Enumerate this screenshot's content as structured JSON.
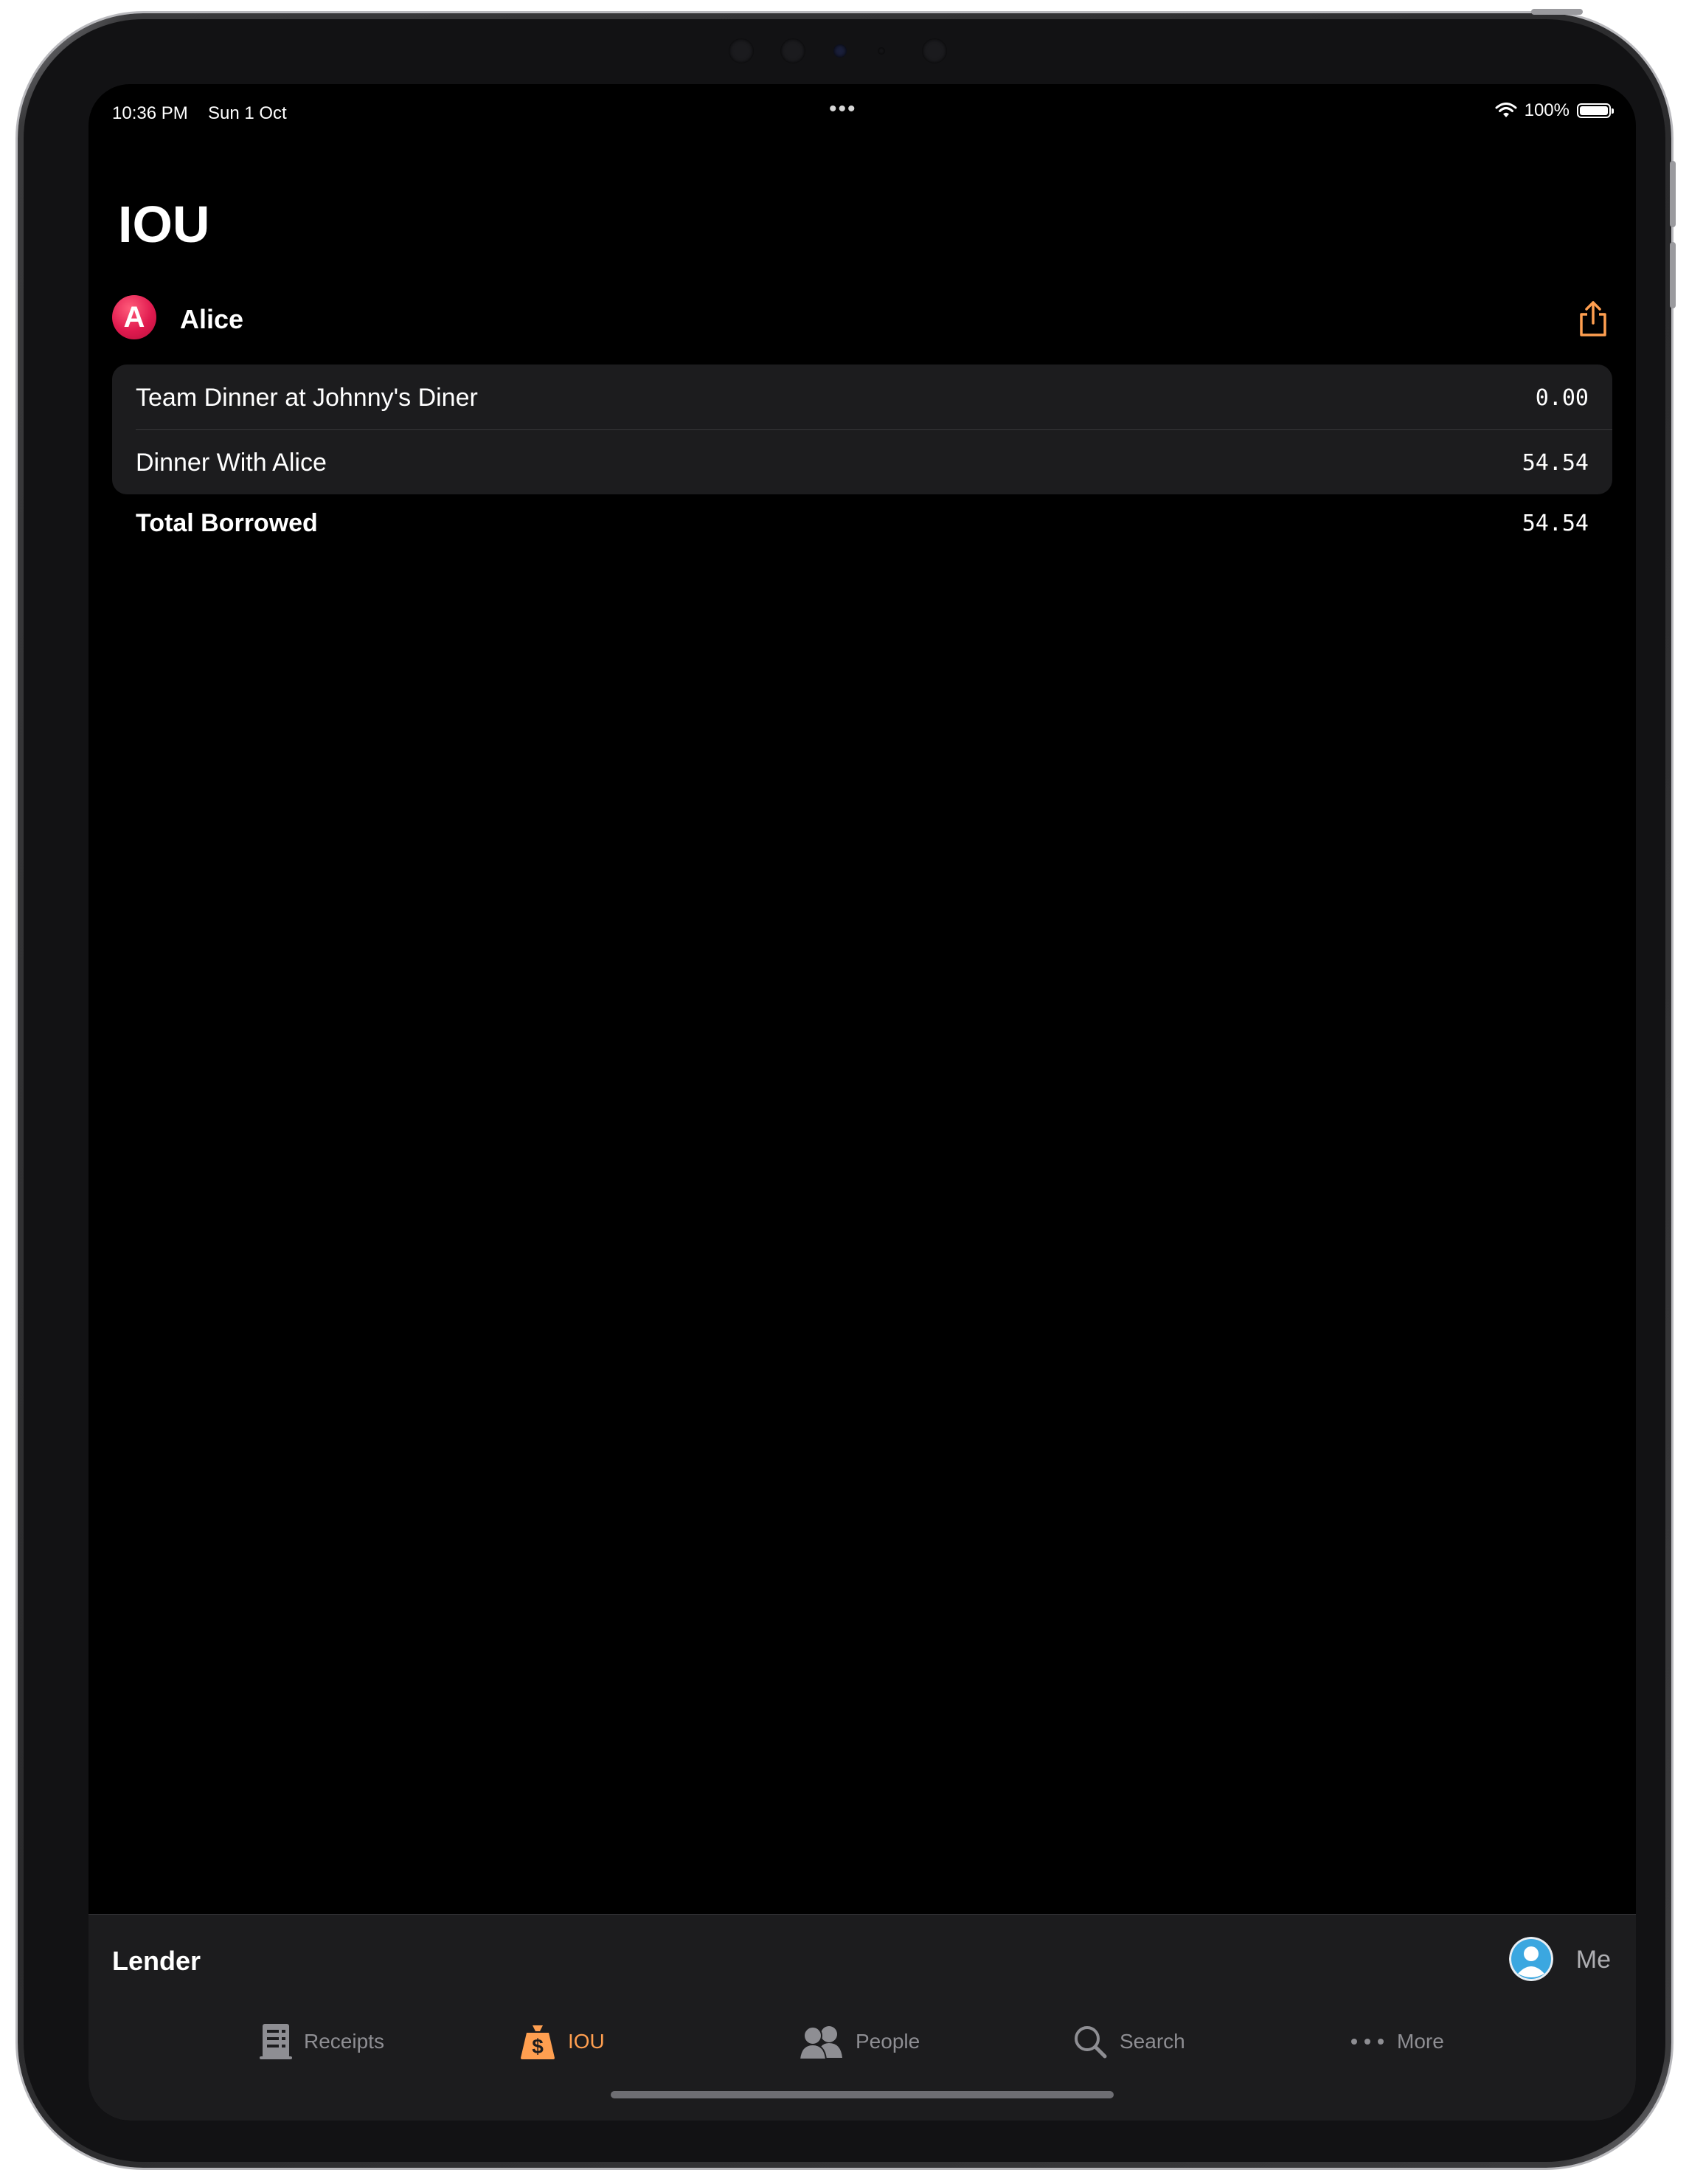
{
  "status_bar": {
    "time": "10:36 PM",
    "date": "Sun 1 Oct",
    "battery": "100%",
    "battery_level": 1.0,
    "icons": [
      "wifi-icon",
      "battery-icon",
      "multitasking-dots-icon"
    ]
  },
  "page": {
    "title": "IOU"
  },
  "person": {
    "initial": "A",
    "name": "Alice",
    "avatar_color": "#e01a4f",
    "share_icon": "share-icon"
  },
  "entries": [
    {
      "label": "Team Dinner at Johnny's Diner",
      "amount": "0.00"
    },
    {
      "label": "Dinner With Alice",
      "amount": "54.54"
    }
  ],
  "total": {
    "label": "Total Borrowed",
    "amount": "54.54"
  },
  "bottom_bar": {
    "lender_label": "Lender",
    "me_label": "Me",
    "tabs": [
      {
        "label": "Receipts",
        "icon": "receipt-icon",
        "active": false
      },
      {
        "label": "IOU",
        "icon": "money-bag-icon",
        "active": true
      },
      {
        "label": "People",
        "icon": "people-icon",
        "active": false
      },
      {
        "label": "Search",
        "icon": "search-icon",
        "active": false
      },
      {
        "label": "More",
        "icon": "more-icon",
        "active": false
      }
    ]
  },
  "colors": {
    "accent": "#ff9f50",
    "background": "#000000",
    "card": "#1c1c1e",
    "inactive_tab": "#8e8e93"
  }
}
